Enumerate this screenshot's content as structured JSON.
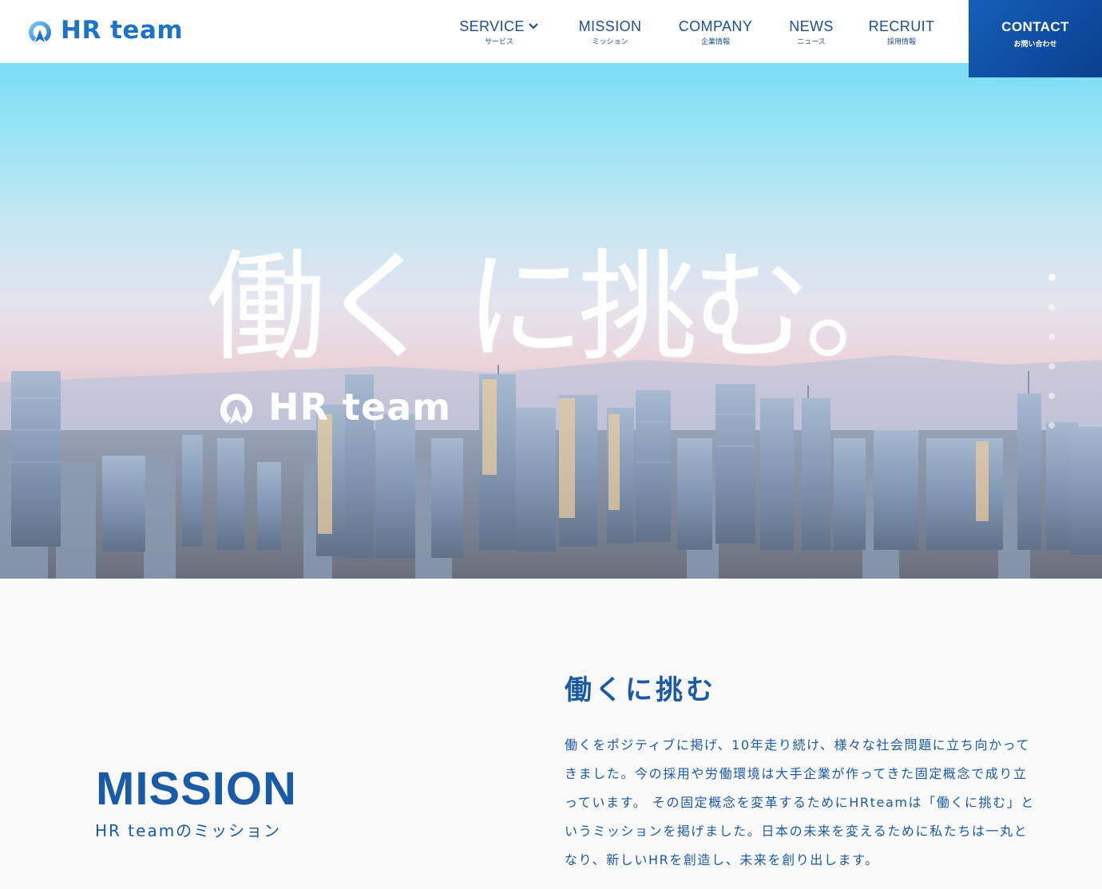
{
  "brand": {
    "name": "HR team",
    "color": "#1e72c8"
  },
  "nav": {
    "items": [
      {
        "label": "SERVICE",
        "sub": "サービス",
        "has_dropdown": true
      },
      {
        "label": "MISSION",
        "sub": "ミッション"
      },
      {
        "label": "COMPANY",
        "sub": "企業情報"
      },
      {
        "label": "NEWS",
        "sub": "ニュース"
      },
      {
        "label": "RECRUIT",
        "sub": "採用情報"
      }
    ],
    "contact": {
      "label": "CONTACT",
      "sub": "お問い合わせ"
    }
  },
  "hero": {
    "title": "働く に挑む。",
    "logo_text": "HR team",
    "slider": {
      "count": 6,
      "active_index": 0
    }
  },
  "mission": {
    "title": "MISSION",
    "subtitle": "HR teamのミッション",
    "heading": "働くに挑む",
    "body": "働くをポジティブに掲げ、10年走り続け、様々な社会問題に立ち向かってきました。今の採用や労働環境は大手企業が作ってきた固定概念で成り立っています。 その固定概念を変革するためにHRteamは「働くに挑む」というミッションを掲げました。日本の未来を変えるために私たちは一丸となり、新しいHRを創造し、未来を創り出します。"
  },
  "colors": {
    "primary": "#1a5aa6",
    "contact_bg": "#0a3f8e",
    "hero_sky": "#4fd2f3"
  }
}
